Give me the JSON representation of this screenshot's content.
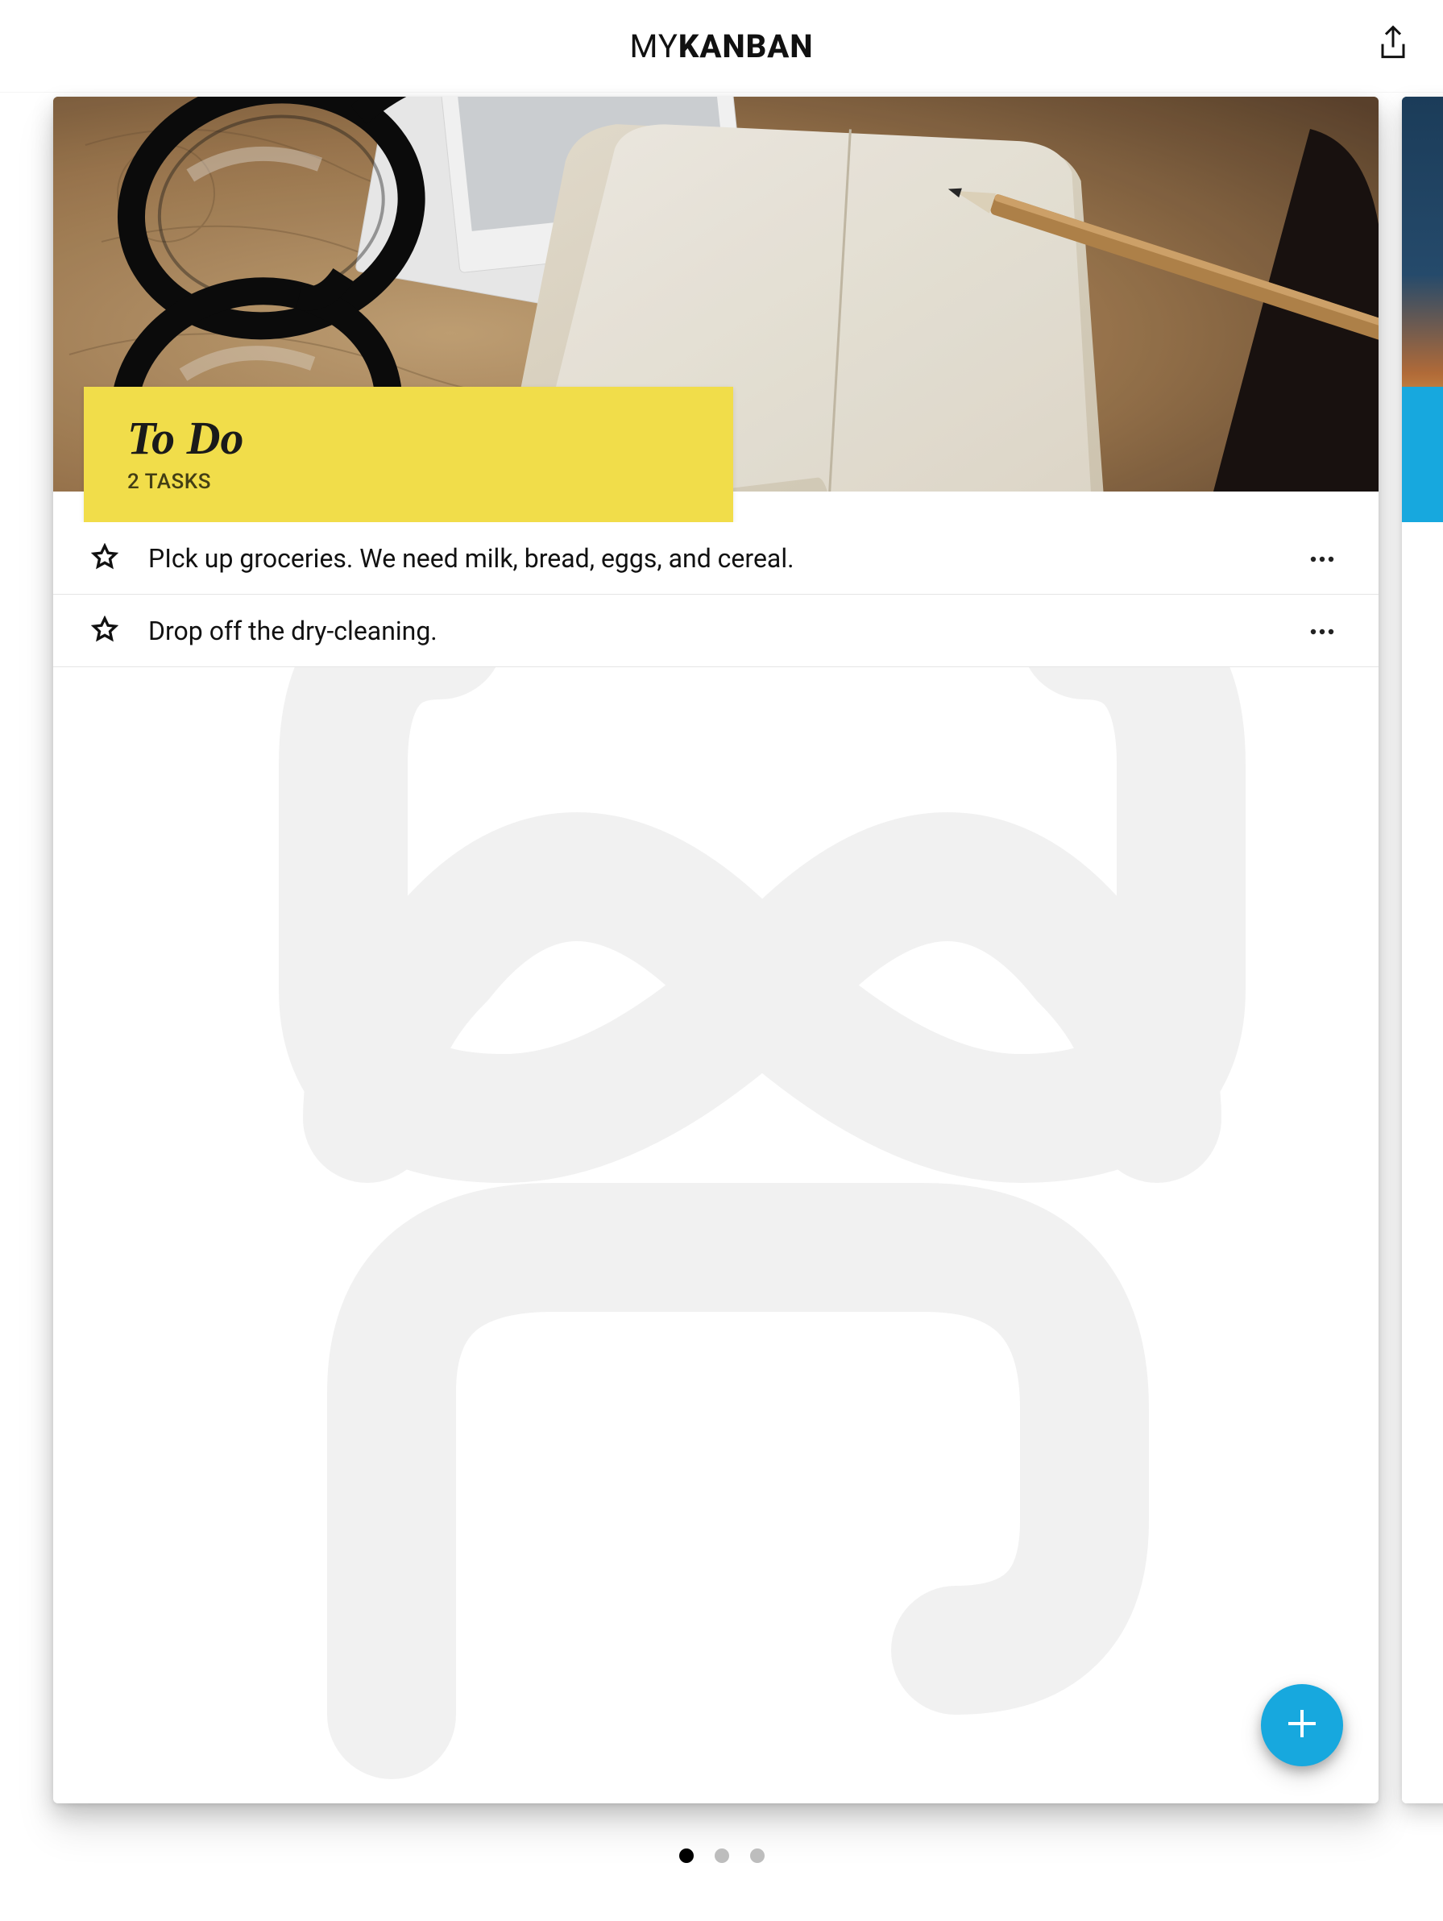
{
  "header": {
    "app_title_thin": "MY",
    "app_title_bold": "KANBAN"
  },
  "board": {
    "column_title": "To Do",
    "task_count_label": "2 TASKS",
    "accent_color": "#f1dd4a",
    "tasks": [
      {
        "text": "PIck up groceries. We need milk, bread, eggs, and cereal.",
        "starred": false
      },
      {
        "text": "Drop off the dry-cleaning.",
        "starred": false
      }
    ]
  },
  "fab": {
    "accent_color": "#17a8de"
  },
  "pager": {
    "total": 3,
    "active_index": 0
  },
  "icons": {
    "share": "share-up-icon",
    "star": "star-outline-icon",
    "more": "more-horizontal-icon",
    "add": "plus-icon"
  }
}
